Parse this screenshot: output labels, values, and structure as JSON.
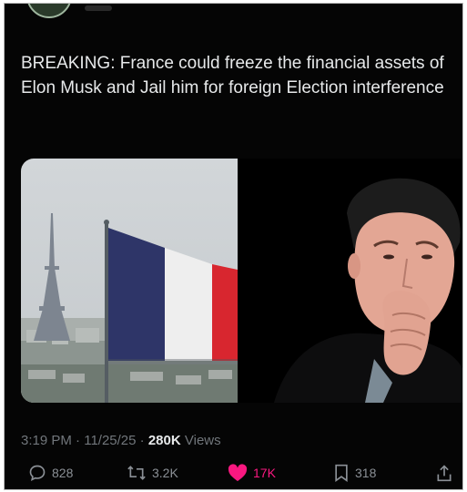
{
  "tweet": {
    "text": "BREAKING: France could freeze the financial assets of Elon Musk and Jail him for foreign Election interference",
    "time": "3:19 PM",
    "date": "11/25/25",
    "views_count": "280K",
    "views_label": "Views"
  },
  "actions": {
    "replies": "828",
    "reposts": "3.2K",
    "likes": "17K",
    "bookmarks": "318"
  },
  "icons": [
    "reply-icon",
    "repost-icon",
    "like-icon",
    "bookmark-icon",
    "share-icon"
  ],
  "colors": {
    "background": "#050505",
    "text": "#e7e9ea",
    "muted": "#71767b",
    "like": "#f91880"
  }
}
